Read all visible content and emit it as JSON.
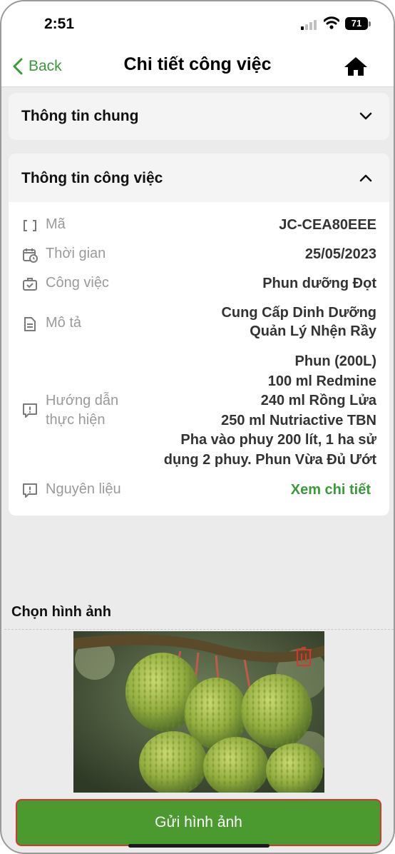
{
  "status_bar": {
    "time": "2:51",
    "battery": "71"
  },
  "nav": {
    "back_label": "Back",
    "title": "Chi tiết công việc"
  },
  "general_section": {
    "title": "Thông tin chung"
  },
  "job_section": {
    "title": "Thông tin công việc",
    "rows": [
      {
        "label": "Mã",
        "value_lines": [
          "JC-CEA80EEE"
        ]
      },
      {
        "label": "Thời gian",
        "value_lines": [
          "25/05/2023"
        ]
      },
      {
        "label": "Công việc",
        "value_lines": [
          "Phun dưỡng Đọt"
        ]
      },
      {
        "label": "Mô tả",
        "value_lines": [
          "Cung Cấp Dinh Dưỡng",
          "Quản Lý Nhện Rầy"
        ]
      },
      {
        "label_lines": [
          "Hướng dẫn",
          "thực hiện"
        ],
        "value_lines": [
          "Phun (200L)",
          "100 ml Redmine",
          "240 ml Rồng Lửa",
          "250 ml Nutriactive TBN",
          "Pha vào phuy 200 lít, 1 ha sử",
          "dụng 2 phuy. Phun Vừa Đủ Ướt"
        ]
      },
      {
        "label": "Nguyên liệu",
        "link": "Xem chi tiết"
      }
    ]
  },
  "image_section": {
    "title": "Chọn hình ảnh"
  },
  "submit": {
    "label": "Gửi hình ảnh"
  },
  "colors": {
    "accent_green": "#3a9a3a",
    "button_green": "#4a9a30",
    "button_border": "#cf3a32",
    "delete_red": "#d8352c"
  },
  "icons": [
    "chevron-left-icon",
    "home-icon",
    "chevron-down-icon",
    "chevron-up-icon",
    "brackets-icon",
    "calendar-clock-icon",
    "briefcase-check-icon",
    "document-icon",
    "comment-alert-icon",
    "trash-icon"
  ]
}
